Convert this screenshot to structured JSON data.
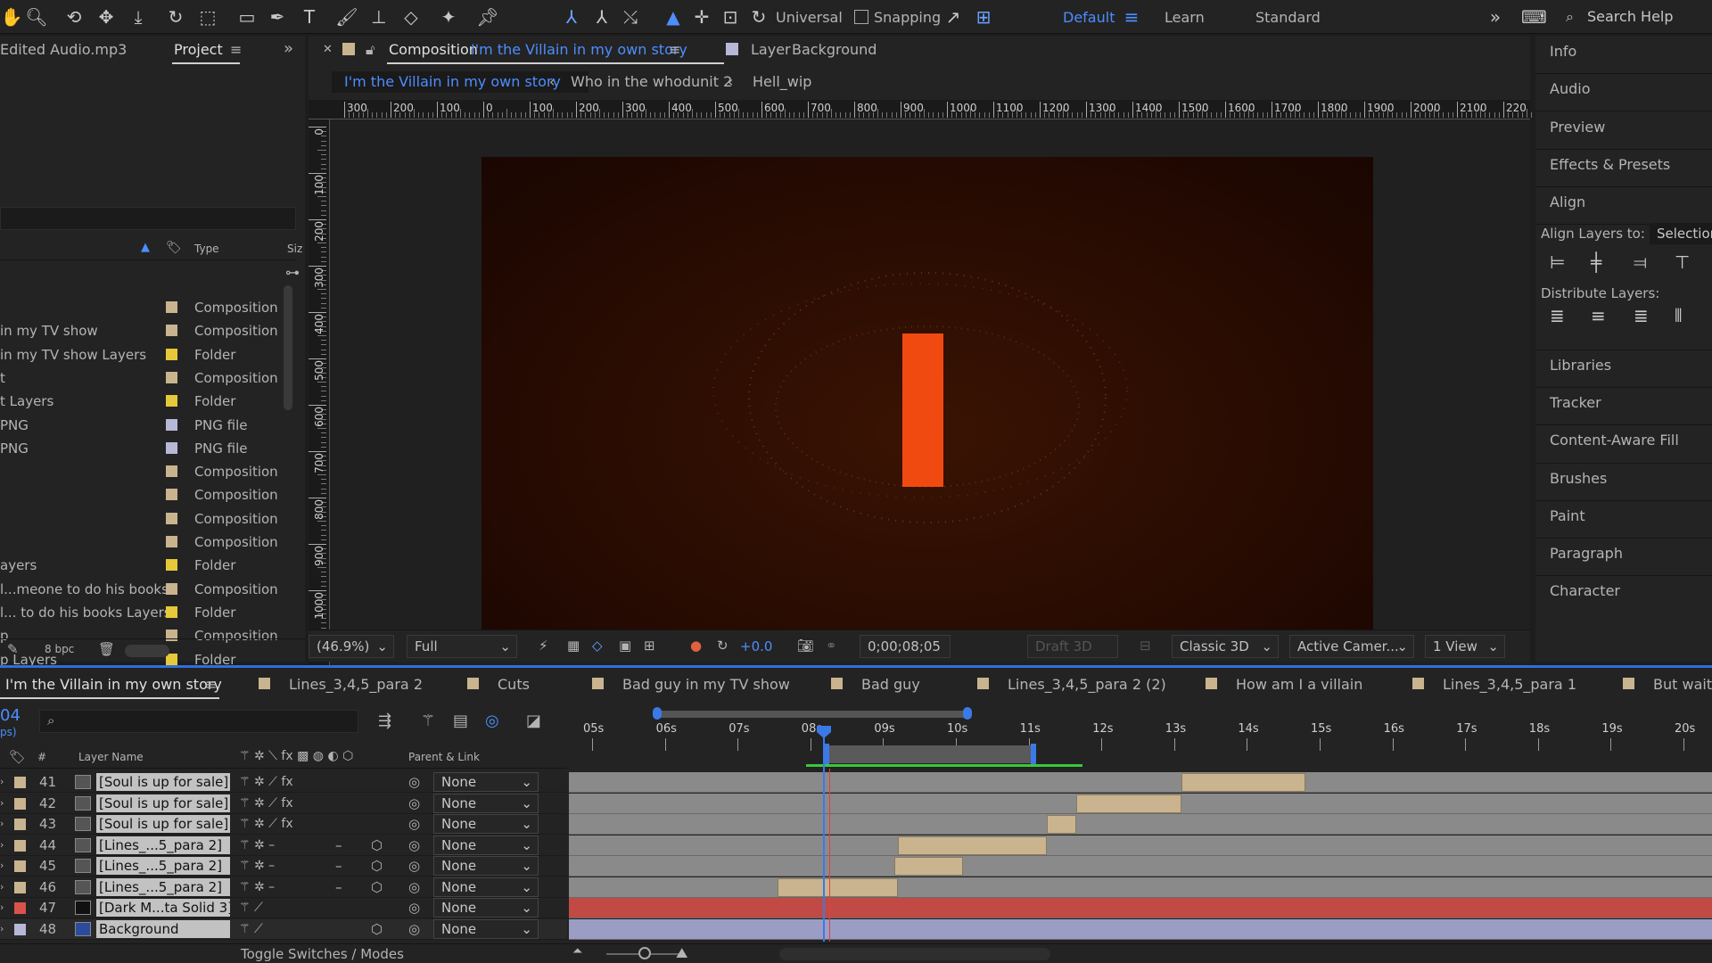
{
  "toolbar": {
    "universal_label": "Universal",
    "snapping_label": "Snapping",
    "workspaces": [
      "Default",
      "Learn",
      "Standard"
    ],
    "search_placeholder": "Search Help"
  },
  "project_panel": {
    "partial_tab": "Edited Audio.mp3",
    "tab_label": "Project",
    "header_type": "Type",
    "header_size": "Siz",
    "bpc_label": "8 bpc",
    "items": [
      {
        "name": "",
        "type": "Composition",
        "color": "#c9b48f"
      },
      {
        "name": "in my TV show",
        "type": "Composition",
        "color": "#c9b48f"
      },
      {
        "name": "in my TV show Layers",
        "type": "Folder",
        "color": "#e6c83a"
      },
      {
        "name": "t",
        "type": "Composition",
        "color": "#c9b48f"
      },
      {
        "name": "t Layers",
        "type": "Folder",
        "color": "#e6c83a"
      },
      {
        "name": "PNG",
        "type": "PNG file",
        "color": "#b7b8d8"
      },
      {
        "name": "PNG",
        "type": "PNG file",
        "color": "#b7b8d8"
      },
      {
        "name": "",
        "type": "Composition",
        "color": "#c9b48f"
      },
      {
        "name": "",
        "type": "Composition",
        "color": "#c9b48f"
      },
      {
        "name": "",
        "type": "Composition",
        "color": "#c9b48f"
      },
      {
        "name": "",
        "type": "Composition",
        "color": "#c9b48f"
      },
      {
        "name": "ayers",
        "type": "Folder",
        "color": "#e6c83a"
      },
      {
        "name": "l...meone to do his books",
        "type": "Composition",
        "color": "#c9b48f"
      },
      {
        "name": "l... to do his books Layers",
        "type": "Folder",
        "color": "#e6c83a"
      },
      {
        "name": "p",
        "type": "Composition",
        "color": "#c9b48f"
      },
      {
        "name": "p Layers",
        "type": "Folder",
        "color": "#e6c83a"
      }
    ]
  },
  "viewer": {
    "comp_prefix": "Composition",
    "comp_name": "I'm the Villain in my own story",
    "layer_prefix": "Layer",
    "layer_name": "Background",
    "breadcrumbs": [
      "I'm the Villain in my own story",
      "Who in the whodunit 2",
      "Hell_wip"
    ],
    "ruler_h": [
      "300",
      "200",
      "100",
      "0",
      "100",
      "200",
      "300",
      "400",
      "500",
      "600",
      "700",
      "800",
      "900",
      "1000",
      "1100",
      "1200",
      "1300",
      "1400",
      "1500",
      "1600",
      "1700",
      "1800",
      "1900",
      "2000",
      "2100",
      "220"
    ],
    "ruler_v": [
      "0",
      "100",
      "200",
      "300",
      "400",
      "500",
      "600",
      "700",
      "800",
      "900",
      "1000"
    ],
    "zoom": "(46.9%)",
    "resolution": "Full",
    "exposure": "+0.0",
    "timecode": "0;00;08;05",
    "draft3d": "Draft 3D",
    "renderer": "Classic 3D",
    "camera": "Active Camer...",
    "views": "1 View",
    "colors": {
      "bg_center": "#3a1303",
      "bg_edge": "#1a0602",
      "rect": "#f04a10"
    }
  },
  "right_panel": {
    "items_top": [
      "Info",
      "Audio",
      "Preview",
      "Effects & Presets",
      "Align"
    ],
    "align_layers_to": "Align Layers to:",
    "align_target": "Selection",
    "distribute_layers": "Distribute Layers:",
    "items_bottom": [
      "Libraries",
      "Tracker",
      "Content-Aware Fill",
      "Brushes",
      "Paint",
      "Paragraph",
      "Character"
    ]
  },
  "timeline": {
    "tabs": [
      {
        "label": "I'm the Villain in my own story",
        "color": ""
      },
      {
        "label": "Lines_3,4,5_para 2",
        "color": "#c9b48f"
      },
      {
        "label": "Cuts",
        "color": "#c9b48f"
      },
      {
        "label": "Bad guy in my TV show",
        "color": "#c9b48f"
      },
      {
        "label": "Bad guy",
        "color": "#c9b48f"
      },
      {
        "label": "Lines_3,4,5_para 2 (2)",
        "color": "#c9b48f"
      },
      {
        "label": "How am I a villain",
        "color": "#c9b48f"
      },
      {
        "label": "Lines_3,4,5_para 1",
        "color": "#c9b48f"
      },
      {
        "label": "But wait",
        "color": "#c9b48f"
      }
    ],
    "time_partial": "04",
    "time_partial_sub": "ps)",
    "col_num": "#",
    "col_layer_name": "Layer Name",
    "col_parent": "Parent & Link",
    "ruler": [
      "05s",
      "06s",
      "07s",
      "08s",
      "09s",
      "10s",
      "11s",
      "12s",
      "13s",
      "14s",
      "15s",
      "16s",
      "17s",
      "18s",
      "19s",
      "20s"
    ],
    "footer": "Toggle Switches / Modes",
    "layers": [
      {
        "num": "41",
        "name": "[Soul is up for sale]",
        "color": "#c9b48f",
        "parent": "None",
        "clip": [
          13.1,
          14.8
        ],
        "bar": "#8a8a8a"
      },
      {
        "num": "42",
        "name": "[Soul is up for sale]",
        "color": "#c9b48f",
        "parent": "None",
        "clip": [
          11.65,
          13.1
        ],
        "bar": "#8a8a8a"
      },
      {
        "num": "43",
        "name": "[Soul is up for sale]",
        "color": "#c9b48f",
        "parent": "None",
        "clip": [
          11.25,
          11.65
        ],
        "bar": "#8a8a8a"
      },
      {
        "num": "44",
        "name": "[Lines_...5_para 2]",
        "color": "#c9b48f",
        "parent": "None",
        "clip": [
          9.2,
          11.25
        ],
        "bar": "#8a8a8a"
      },
      {
        "num": "45",
        "name": "[Lines_...5_para 2]",
        "color": "#c9b48f",
        "parent": "None",
        "clip": [
          9.15,
          10.1
        ],
        "bar": "#8a8a8a"
      },
      {
        "num": "46",
        "name": "[Lines_...5_para 2]",
        "color": "#c9b48f",
        "parent": "None",
        "clip": [
          7.55,
          9.2
        ],
        "bar": "#8a8a8a"
      },
      {
        "num": "47",
        "name": "[Dark M...ta Solid 3]",
        "color": "#d9534a",
        "parent": "None",
        "clip": null,
        "bar": "#c24a45"
      },
      {
        "num": "48",
        "name": "Background",
        "color": "#b7b8d8",
        "parent": "None",
        "clip": null,
        "bar": "#9c9dc4"
      }
    ]
  }
}
